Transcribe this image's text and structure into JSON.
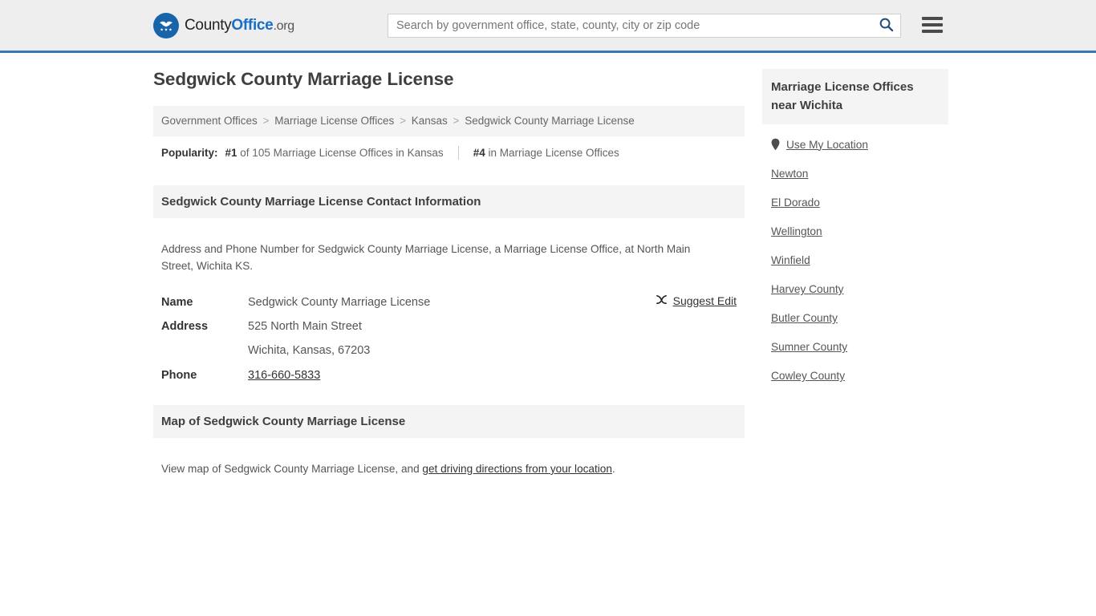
{
  "header": {
    "logo_county": "County",
    "logo_office": "Office",
    "logo_tld": ".org",
    "search_placeholder": "Search by government office, state, county, city or zip code",
    "search_value": "",
    "search_icon": "search-icon",
    "menu_icon": "hamburger-menu-icon",
    "accent_color": "#3b78b0",
    "background": "#eeeeee"
  },
  "page": {
    "title": "Sedgwick County Marriage License"
  },
  "breadcrumb": {
    "items": [
      {
        "label": "Government Offices",
        "is_link": true
      },
      {
        "label": "Marriage License Offices",
        "is_link": true
      },
      {
        "label": "Kansas",
        "is_link": true
      },
      {
        "label": "Sedgwick County Marriage License",
        "is_link": false
      }
    ],
    "separator": ">"
  },
  "popularity": {
    "label": "Popularity:",
    "rank_primary_number": "#1",
    "rank_primary_text": " of 105 Marriage License Offices in Kansas",
    "rank_secondary_number": "#4",
    "rank_secondary_text": " in Marriage License Offices"
  },
  "contact_section": {
    "heading": "Sedgwick County Marriage License Contact Information",
    "description": "Address and Phone Number for Sedgwick County Marriage License, a Marriage License Office, at North Main Street, Wichita KS.",
    "rows": [
      {
        "label": "Name",
        "value": "Sedgwick County Marriage License",
        "type": "text"
      },
      {
        "label": "Address",
        "value": "525 North Main Street",
        "type": "text"
      },
      {
        "label": "",
        "value": "Wichita, Kansas, 67203",
        "type": "text"
      },
      {
        "label": "Phone",
        "value": "316-660-5833",
        "type": "link"
      }
    ],
    "suggest_edit_label": "Suggest Edit",
    "suggest_edit_icon": "edit-pencil-icon"
  },
  "map_section": {
    "heading": "Map of Sedgwick County Marriage License",
    "description_prefix": "View map of Sedgwick County Marriage License, and ",
    "description_link": "get driving directions from your location",
    "description_suffix": "."
  },
  "sidebar": {
    "heading": "Marriage License Offices near Wichita",
    "use_my_location": {
      "label": "Use My Location",
      "icon": "map-pin-icon"
    },
    "links": [
      {
        "label": "Newton"
      },
      {
        "label": "El Dorado"
      },
      {
        "label": "Wellington"
      },
      {
        "label": "Winfield"
      },
      {
        "label": "Harvey County"
      },
      {
        "label": "Butler County"
      },
      {
        "label": "Sumner County"
      },
      {
        "label": "Cowley County"
      }
    ]
  }
}
